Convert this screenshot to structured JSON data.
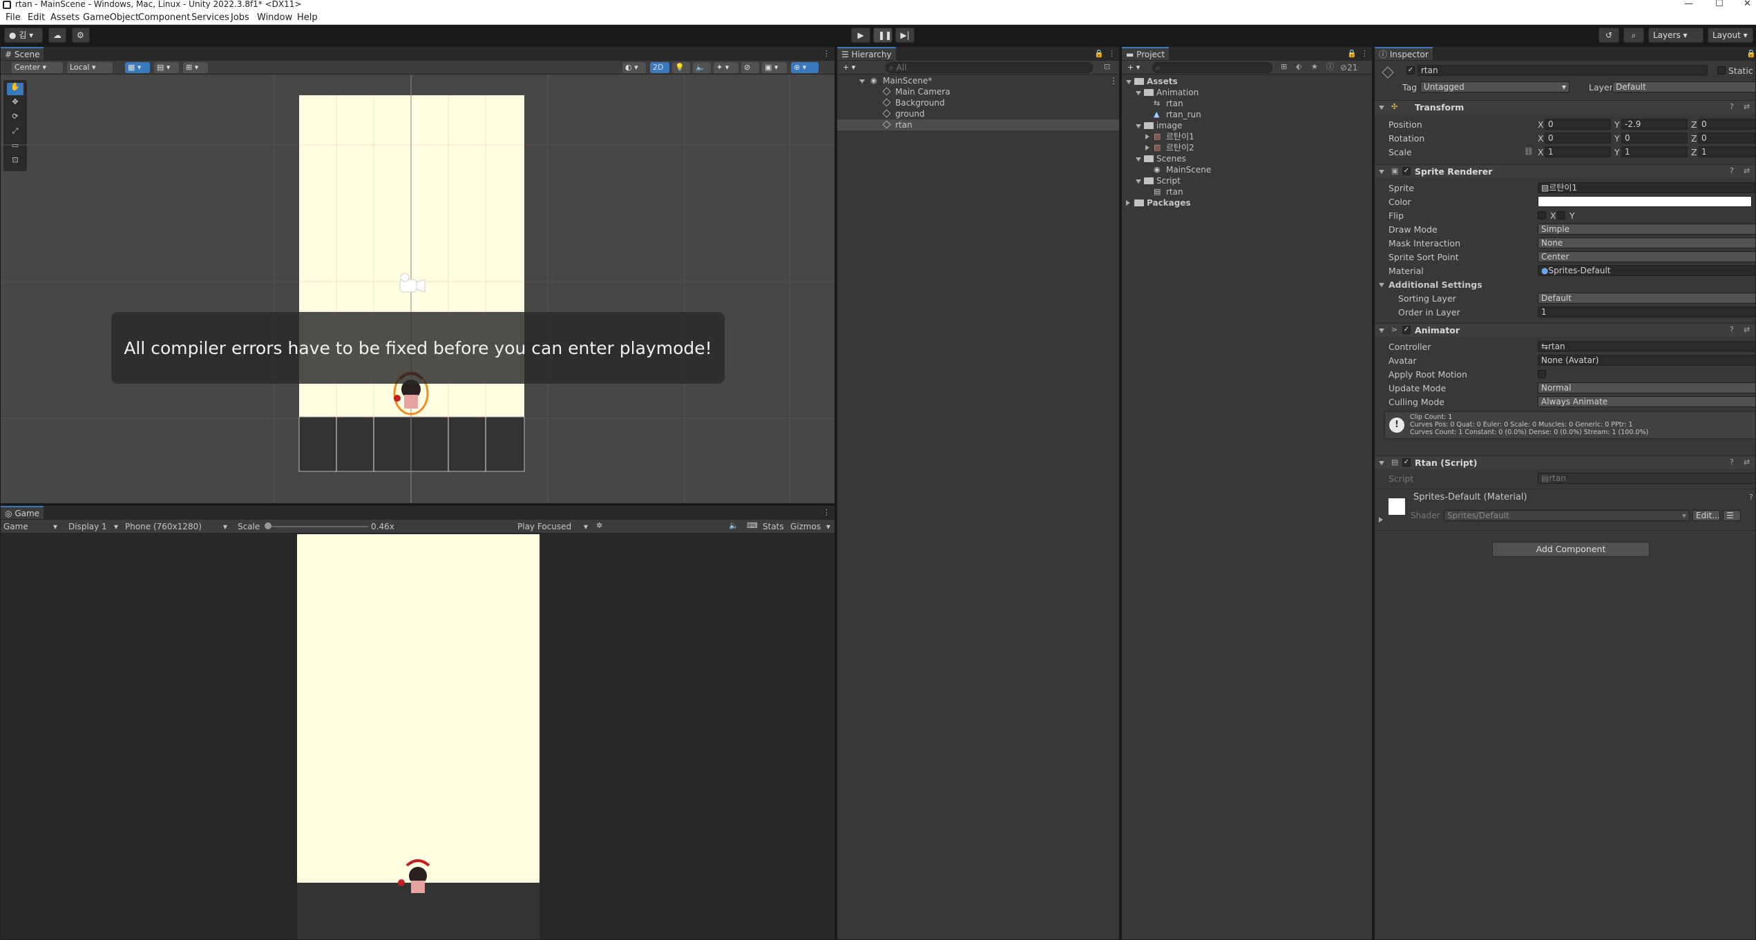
{
  "window": {
    "title": "rtan - MainScene - Windows, Mac, Linux - Unity 2022.3.8f1* <DX11>",
    "minimize": "—",
    "maximize": "☐",
    "close": "✕"
  },
  "menu": [
    "File",
    "Edit",
    "Assets",
    "GameObject",
    "Component",
    "Services",
    "Jobs",
    "Window",
    "Help"
  ],
  "toolbar": {
    "account_label": "김",
    "layers": "Layers",
    "layout": "Layout"
  },
  "scene": {
    "tab": "Scene",
    "pivot": "Center",
    "space": "Local",
    "mode_2d": "2D",
    "message": "All compiler errors have to be fixed before you can enter playmode!"
  },
  "game": {
    "tab": "Game",
    "view": "Game",
    "display": "Display 1",
    "resolution": "Phone (760x1280)",
    "scale_label": "Scale",
    "scale_value": "0.46x",
    "scale_fraction": 0.02,
    "focus": "Play Focused",
    "stats": "Stats",
    "gizmos": "Gizmos"
  },
  "hierarchy": {
    "tab": "Hierarchy",
    "search_placeholder": "All",
    "scene": "MainScene*",
    "items": [
      "Main Camera",
      "Background",
      "ground",
      "rtan"
    ]
  },
  "project": {
    "tab": "Project",
    "hidden_count": "21",
    "tree": [
      {
        "label": "Assets",
        "depth": 0,
        "kind": "folder",
        "bold": true
      },
      {
        "label": "Animation",
        "depth": 1,
        "kind": "folder"
      },
      {
        "label": "rtan",
        "depth": 2,
        "kind": "animator"
      },
      {
        "label": "rtan_run",
        "depth": 2,
        "kind": "clip"
      },
      {
        "label": "image",
        "depth": 1,
        "kind": "folder"
      },
      {
        "label": "르탄이1",
        "depth": 2,
        "kind": "sprite"
      },
      {
        "label": "르탄이2",
        "depth": 2,
        "kind": "sprite"
      },
      {
        "label": "Scenes",
        "depth": 1,
        "kind": "folder"
      },
      {
        "label": "MainScene",
        "depth": 2,
        "kind": "scene"
      },
      {
        "label": "Script",
        "depth": 1,
        "kind": "folder"
      },
      {
        "label": "rtan",
        "depth": 2,
        "kind": "script"
      },
      {
        "label": "Packages",
        "depth": 0,
        "kind": "folder",
        "bold": true
      }
    ]
  },
  "inspector": {
    "tab": "Inspector",
    "object_name": "rtan",
    "static_label": "Static",
    "tag_label": "Tag",
    "tag_value": "Untagged",
    "layer_label": "Layer",
    "layer_value": "Default",
    "transform": {
      "title": "Transform",
      "position_label": "Position",
      "rotation_label": "Rotation",
      "scale_label": "Scale",
      "position": [
        "0",
        "-2.9",
        "0"
      ],
      "rotation": [
        "0",
        "0",
        "0"
      ],
      "scale": [
        "1",
        "1",
        "1"
      ]
    },
    "sprite_renderer": {
      "title": "Sprite Renderer",
      "sprite_label": "Sprite",
      "sprite": "르탄이1",
      "color_label": "Color",
      "flip_label": "Flip",
      "flip_x": "X",
      "flip_y": "Y",
      "draw_mode_label": "Draw Mode",
      "draw_mode": "Simple",
      "mask_label": "Mask Interaction",
      "mask": "None",
      "sort_point_label": "Sprite Sort Point",
      "sort_point": "Center",
      "material_label": "Material",
      "material": "Sprites-Default",
      "additional": "Additional Settings",
      "sorting_layer_label": "Sorting Layer",
      "sorting_layer": "Default",
      "order_label": "Order in Layer",
      "order": "1"
    },
    "animator": {
      "title": "Animator",
      "controller_label": "Controller",
      "controller": "rtan",
      "avatar_label": "Avatar",
      "avatar": "None (Avatar)",
      "root_motion_label": "Apply Root Motion",
      "update_label": "Update Mode",
      "update": "Normal",
      "culling_label": "Culling Mode",
      "culling": "Always Animate",
      "info1": "Clip Count: 1",
      "info2": "Curves Pos: 0 Quat: 0 Euler: 0 Scale: 0 Muscles: 0 Generic: 0 PPtr: 1",
      "info3": "Curves Count: 1 Constant: 0 (0.0%) Dense: 0 (0.0%) Stream: 1 (100.0%)"
    },
    "script": {
      "title": "Rtan (Script)",
      "script_label": "Script",
      "script": "rtan"
    },
    "material": {
      "title": "Sprites-Default (Material)",
      "shader_label": "Shader",
      "shader": "Sprites/Default",
      "edit": "Edit..."
    },
    "add_component": "Add Component"
  },
  "colors": {
    "accent": "#3a79bb",
    "scene_bg": "#474747",
    "sky": "#fffee2",
    "ground": "#333333"
  }
}
